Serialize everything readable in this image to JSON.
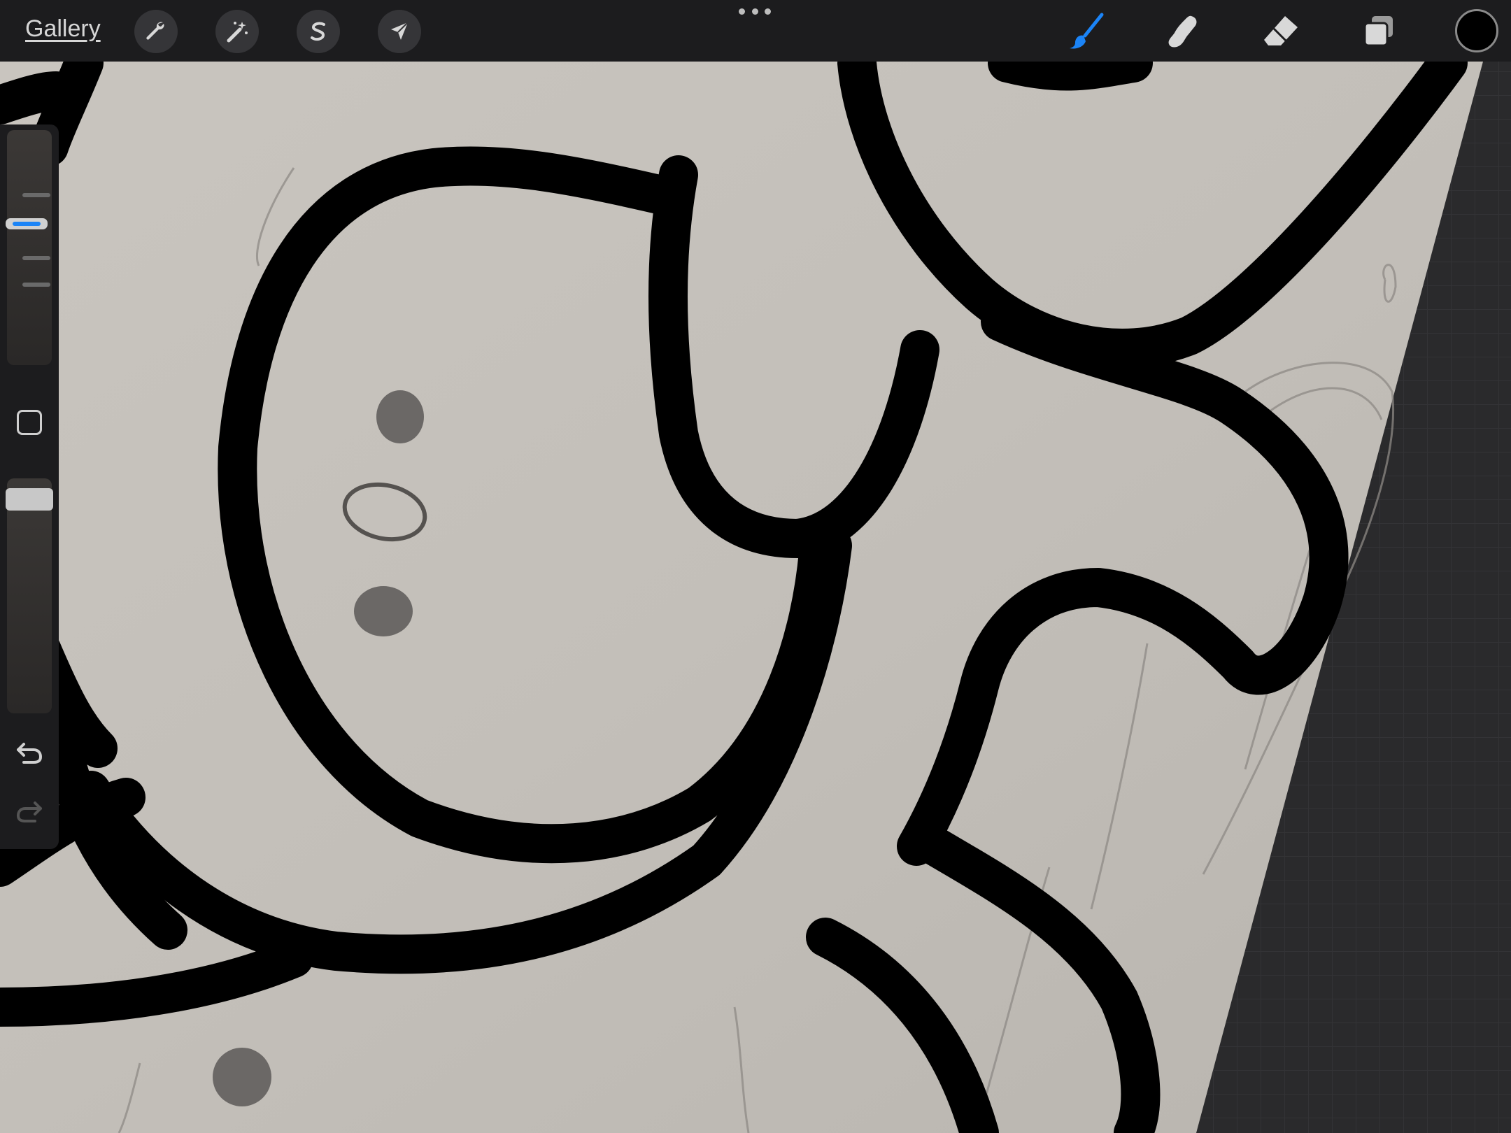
{
  "toolbar": {
    "gallery_label": "Gallery",
    "left_tools": [
      {
        "name": "actions",
        "icon": "wrench-icon"
      },
      {
        "name": "adjustments",
        "icon": "magic-wand-icon"
      },
      {
        "name": "selection",
        "icon": "selection-s-icon"
      },
      {
        "name": "transform",
        "icon": "arrow-cursor-icon"
      }
    ],
    "more_menu_icon": "ellipsis-icon",
    "right_tools": [
      {
        "name": "brush",
        "icon": "brush-icon",
        "active": true
      },
      {
        "name": "smudge",
        "icon": "smudge-finger-icon",
        "active": false
      },
      {
        "name": "eraser",
        "icon": "eraser-icon",
        "active": false
      },
      {
        "name": "layers",
        "icon": "layers-icon",
        "active": false
      }
    ],
    "current_color": "#000000",
    "active_accent": "#1b84f7"
  },
  "sidebar": {
    "brush_size_level": 0.74,
    "opacity_level": 0.95,
    "modify_icon": "square-icon",
    "undo_icon": "undo-arrow-icon",
    "redo_icon": "redo-arrow-icon"
  }
}
